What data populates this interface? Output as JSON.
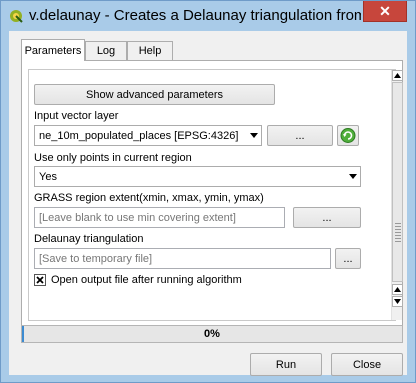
{
  "window": {
    "title": "v.delaunay - Creates a Delaunay triangulation from an in...",
    "close_label": "✕"
  },
  "tabs": [
    {
      "label": "Parameters",
      "active": true
    },
    {
      "label": "Log",
      "active": false
    },
    {
      "label": "Help",
      "active": false
    }
  ],
  "params": {
    "show_advanced_label": "Show advanced parameters",
    "input_layer_label": "Input vector layer",
    "input_layer_value": "ne_10m_populated_places [EPSG:4326]",
    "browse_label": "...",
    "use_points_label": "Use only points in current region",
    "use_points_value": "Yes",
    "region_label": "GRASS region extent(xmin, xmax, ymin, ymax)",
    "region_placeholder": "[Leave blank to use min covering extent]",
    "region_browse_label": "...",
    "triangulation_label": "Delaunay triangulation",
    "triangulation_placeholder": "[Save to temporary file]",
    "triangulation_browse_label": "...",
    "open_output_label": "Open output file after running algorithm",
    "open_output_checked": true
  },
  "progress": {
    "value": 0,
    "text": "0%"
  },
  "buttons": {
    "run": "Run",
    "close": "Close"
  },
  "colors": {
    "title_bar": "#a9cbe8",
    "close_button": "#c7463c",
    "progress_fill": "#3c8bd1"
  }
}
